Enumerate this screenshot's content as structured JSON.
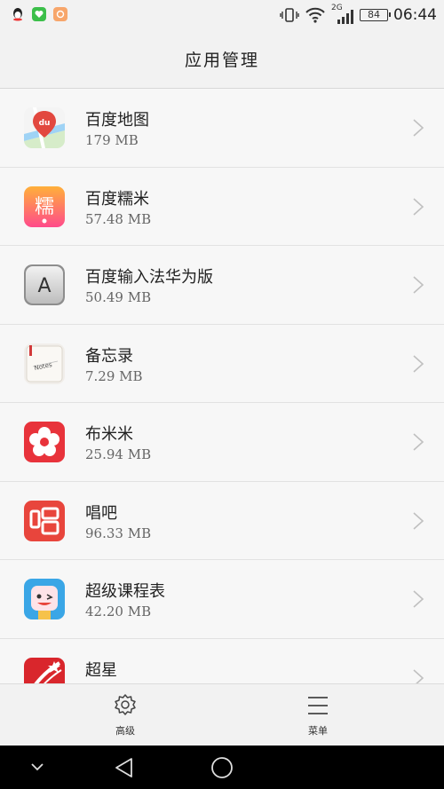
{
  "status_bar": {
    "network": "2G",
    "battery": "84",
    "time": "06:44"
  },
  "header": {
    "title": "应用管理"
  },
  "apps": [
    {
      "name": "百度地图",
      "size": "179 MB",
      "icon": "baidu-maps-icon"
    },
    {
      "name": "百度糯米",
      "size": "57.48 MB",
      "icon": "baidu-nuomi-icon"
    },
    {
      "name": "百度输入法华为版",
      "size": "50.49 MB",
      "icon": "baidu-input-icon"
    },
    {
      "name": "备忘录",
      "size": "7.29 MB",
      "icon": "notes-icon"
    },
    {
      "name": "布米米",
      "size": "25.94 MB",
      "icon": "bumimi-icon"
    },
    {
      "name": "唱吧",
      "size": "96.33 MB",
      "icon": "changba-icon"
    },
    {
      "name": "超级课程表",
      "size": "42.20 MB",
      "icon": "super-schedule-icon"
    },
    {
      "name": "超星",
      "size": "",
      "icon": "chaoxing-icon"
    }
  ],
  "toolbar": {
    "advanced_label": "高级",
    "menu_label": "菜单"
  },
  "colors": {
    "background": "#f7f7f7",
    "bar": "#f2f2f2",
    "nav": "#000000"
  }
}
